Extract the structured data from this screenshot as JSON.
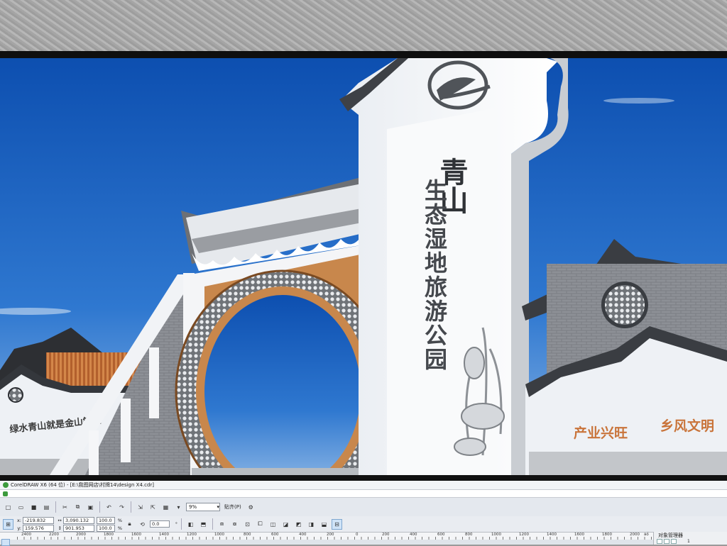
{
  "scene": {
    "tower_title": "青山",
    "tower_subtitle": "生态湿地旅游公园",
    "left_wall_slogan": "绿水青山就是金山银山",
    "right_wall_slogan_1": "产业兴旺",
    "right_wall_slogan_2": "乡风文明"
  },
  "app": {
    "title": "CorelDRAW X6 (64 位) - [E:\\我图网店\\村牌14\\design X4.cdr]"
  },
  "toolbar": {
    "zoom_value": "9%",
    "snap_label": "贴齐(P)"
  },
  "property_bar": {
    "x_label": "x:",
    "x_value": "-219.832 mm",
    "y_label": "y:",
    "y_value": "159.576 mm",
    "w_value": "3,090.132 mm",
    "h_value": "901.953 mm",
    "scale_x": "100.0",
    "scale_y": "100.0",
    "percent": "%",
    "angle_value": "0.0",
    "degree": "°"
  },
  "ruler": {
    "labels": [
      "2400",
      "2200",
      "2000",
      "1800",
      "1600",
      "1400",
      "1200",
      "1000",
      "800",
      "600",
      "400",
      "200",
      "0",
      "200",
      "400",
      "600",
      "800",
      "1000",
      "1200",
      "1400",
      "1600",
      "1800",
      "2000",
      "ăő"
    ]
  },
  "object_manager": {
    "title": "对象管理器",
    "page_number": "1"
  },
  "icons": [
    "new-icon",
    "open-icon",
    "save-icon",
    "print-icon",
    "cut-icon",
    "copy-icon",
    "paste-icon",
    "undo-icon",
    "redo-icon",
    "import-icon",
    "export-icon",
    "publish-icon",
    "zoom-dropdown-icon",
    "snap-icon",
    "options-icon"
  ]
}
